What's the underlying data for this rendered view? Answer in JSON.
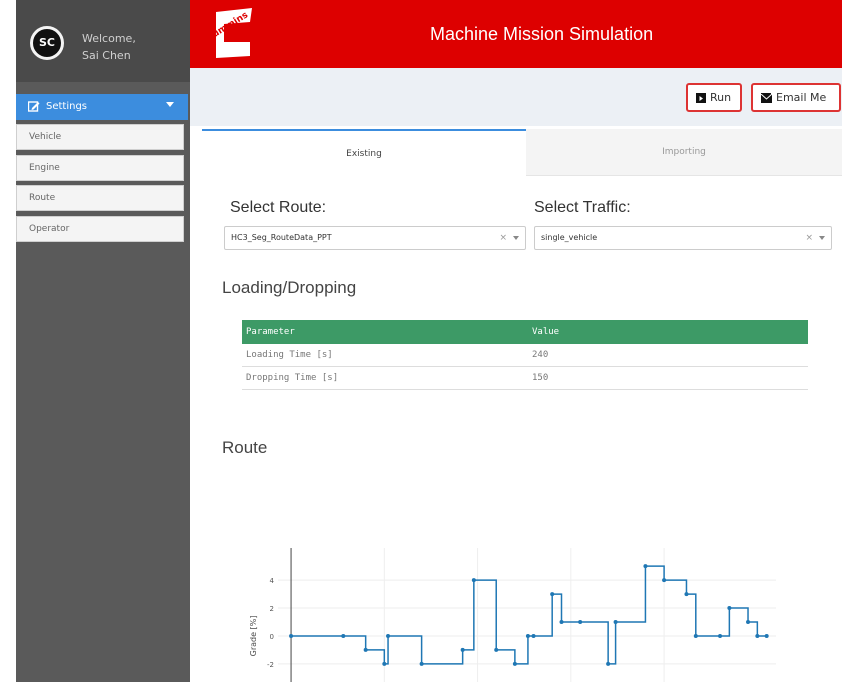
{
  "sidebar": {
    "user": {
      "initials": "SC",
      "welcome": "Welcome,",
      "name": "Sai Chen"
    },
    "active_item": {
      "label": "Settings",
      "icon": "edit-icon"
    },
    "subitems": [
      "Vehicle",
      "Engine",
      "Route",
      "Operator"
    ]
  },
  "header": {
    "logo_text": "Cummins",
    "title": "Machine Mission Simulation",
    "color": "#dd0000"
  },
  "toolbar": {
    "run": {
      "label": "Run",
      "icon": "play-icon"
    },
    "email": {
      "label": "Email Me",
      "icon": "envelope-icon"
    }
  },
  "tabs": [
    {
      "label": "Existing",
      "active": true
    },
    {
      "label": "Importing",
      "active": false
    }
  ],
  "form": {
    "route": {
      "label": "Select Route:",
      "value": "HC3_Seg_RouteData_PPT",
      "clear": "×"
    },
    "traffic": {
      "label": "Select Traffic:",
      "value": "single_vehicle",
      "clear": "×"
    }
  },
  "loading": {
    "title": "Loading/Dropping",
    "headers": [
      "Parameter",
      "Value"
    ],
    "rows": [
      [
        "Loading Time [s]",
        "240"
      ],
      [
        "Dropping Time [s]",
        "150"
      ]
    ],
    "header_color": "#3d9a66"
  },
  "route_section": {
    "title": "Route"
  },
  "chart_data": {
    "type": "line",
    "line_shape": "step",
    "ylabel": "Grade [%]",
    "yticks": [
      "4",
      "2",
      "0",
      "-2"
    ],
    "color": "#1f77b4",
    "points": [
      [
        0.0,
        0
      ],
      [
        0.28,
        0
      ],
      [
        0.4,
        -1
      ],
      [
        0.5,
        -2
      ],
      [
        0.52,
        0
      ],
      [
        0.7,
        -2
      ],
      [
        0.92,
        -1
      ],
      [
        0.98,
        4
      ],
      [
        1.1,
        -1
      ],
      [
        1.2,
        -2
      ],
      [
        1.27,
        0
      ],
      [
        1.3,
        0
      ],
      [
        1.4,
        3
      ],
      [
        1.45,
        1
      ],
      [
        1.55,
        1
      ],
      [
        1.7,
        -2
      ],
      [
        1.74,
        1
      ],
      [
        1.9,
        5
      ],
      [
        2.0,
        4
      ],
      [
        2.12,
        3
      ],
      [
        2.17,
        0
      ],
      [
        2.3,
        0
      ],
      [
        2.35,
        2
      ],
      [
        2.45,
        1
      ],
      [
        2.5,
        0
      ],
      [
        2.55,
        0
      ]
    ],
    "xlim": [
      -0.07,
      2.6
    ],
    "ylim": [
      -3.3,
      6.3
    ],
    "grid": true
  }
}
